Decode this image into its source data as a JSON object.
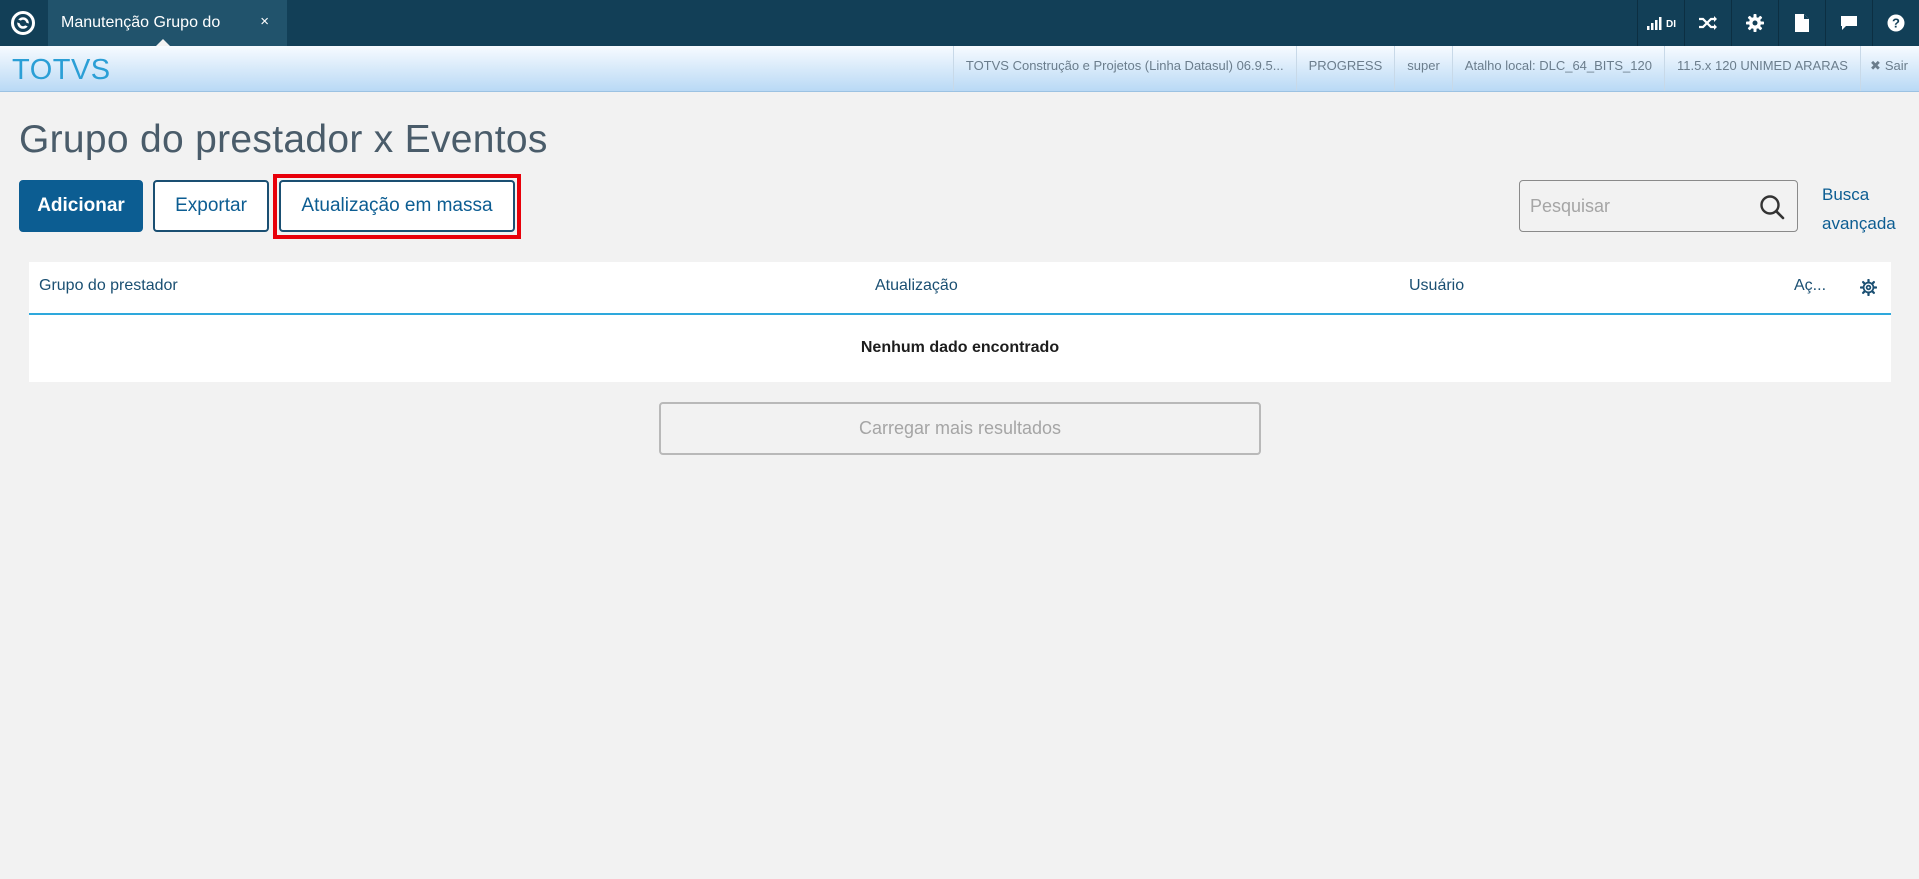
{
  "topbar": {
    "tab_title": "Manutenção Grupo do",
    "tab_close": "×",
    "signal_label": "DI",
    "icons": [
      "totvs-logo-icon",
      "signal-bars-icon",
      "shuffle-icon",
      "gear-icon",
      "document-icon",
      "chat-icon",
      "help-icon"
    ]
  },
  "header": {
    "brand": "TOTVS",
    "product": "TOTVS Construção e Projetos (Linha Datasul) 06.9.5...",
    "database": "PROGRESS",
    "user": "super",
    "shortcut": "Atalho local: DLC_64_BITS_120",
    "environment": "11.5.x 120 UNIMED ARARAS",
    "logout_icon": "✖",
    "logout_label": "Sair"
  },
  "page": {
    "title": "Grupo do prestador x Eventos",
    "buttons": {
      "add": "Adicionar",
      "export": "Exportar",
      "mass_update": "Atualização em massa"
    },
    "search": {
      "placeholder": "Pesquisar",
      "value": ""
    },
    "advanced_search_line1": "Busca",
    "advanced_search_line2": "avançada"
  },
  "table": {
    "columns": [
      "Grupo do prestador",
      "Atualização",
      "Usuário",
      "Aç..."
    ],
    "rows": [],
    "empty_message": "Nenhum dado encontrado"
  },
  "load_more": "Carregar mais resultados",
  "colors": {
    "topbar": "#123f57",
    "tab": "#21536c",
    "primary": "#0c5d92",
    "brand": "#2b9fd6",
    "highlight": "#e8000a",
    "table_header_border": "#2ea8dc"
  }
}
